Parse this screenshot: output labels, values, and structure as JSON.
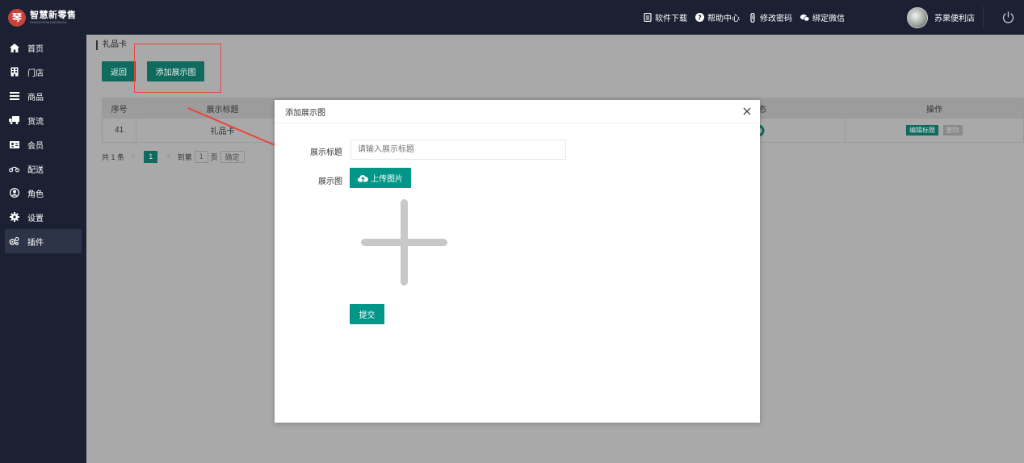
{
  "app": {
    "logo_mark": "琴",
    "logo_name": "智慧新零售",
    "logo_en": "ZHIHUIXINLINGSHOU"
  },
  "topbar": {
    "links": [
      {
        "label": "软件下载",
        "icon": "download-icon"
      },
      {
        "label": "帮助中心",
        "icon": "help-icon"
      },
      {
        "label": "修改密码",
        "icon": "key-icon"
      },
      {
        "label": "绑定微信",
        "icon": "wechat-icon"
      }
    ],
    "username": "苏果便利店",
    "power_icon": "power-icon"
  },
  "sidebar": {
    "items": [
      {
        "label": "首页",
        "icon": "home-icon"
      },
      {
        "label": "门店",
        "icon": "store-icon"
      },
      {
        "label": "商品",
        "icon": "list-icon"
      },
      {
        "label": "货流",
        "icon": "truck-icon"
      },
      {
        "label": "会员",
        "icon": "member-card-icon"
      },
      {
        "label": "配送",
        "icon": "motorbike-icon"
      },
      {
        "label": "角色",
        "icon": "user-circle-icon"
      },
      {
        "label": "设置",
        "icon": "gear-icon"
      },
      {
        "label": "插件",
        "icon": "plugin-gears-icon",
        "active": true
      }
    ]
  },
  "main": {
    "breadcrumb": "礼品卡",
    "back_label": "返回",
    "add_label": "添加展示图",
    "table": {
      "headers": [
        "序号",
        "展示标题",
        "",
        "态",
        "操作"
      ],
      "rows": [
        {
          "id": "41",
          "title": "礼品卡",
          "edit_label": "编辑标题",
          "delete_label": "删除"
        }
      ]
    },
    "pager": {
      "total": "共 1 条",
      "prev": "<",
      "current_page": "1",
      "next": ">",
      "goto_label": "到第",
      "goto_value": "1",
      "page_unit": "页",
      "confirm": "确定"
    }
  },
  "modal": {
    "title": "添加展示图",
    "title_label": "展示标题",
    "title_placeholder": "请输入展示标题",
    "image_label": "展示图",
    "upload_label": "上传图片",
    "submit_label": "提交"
  },
  "colors": {
    "sidebar_bg": "#1c2033",
    "accent": "#009688",
    "annotation": "#e8463c"
  }
}
